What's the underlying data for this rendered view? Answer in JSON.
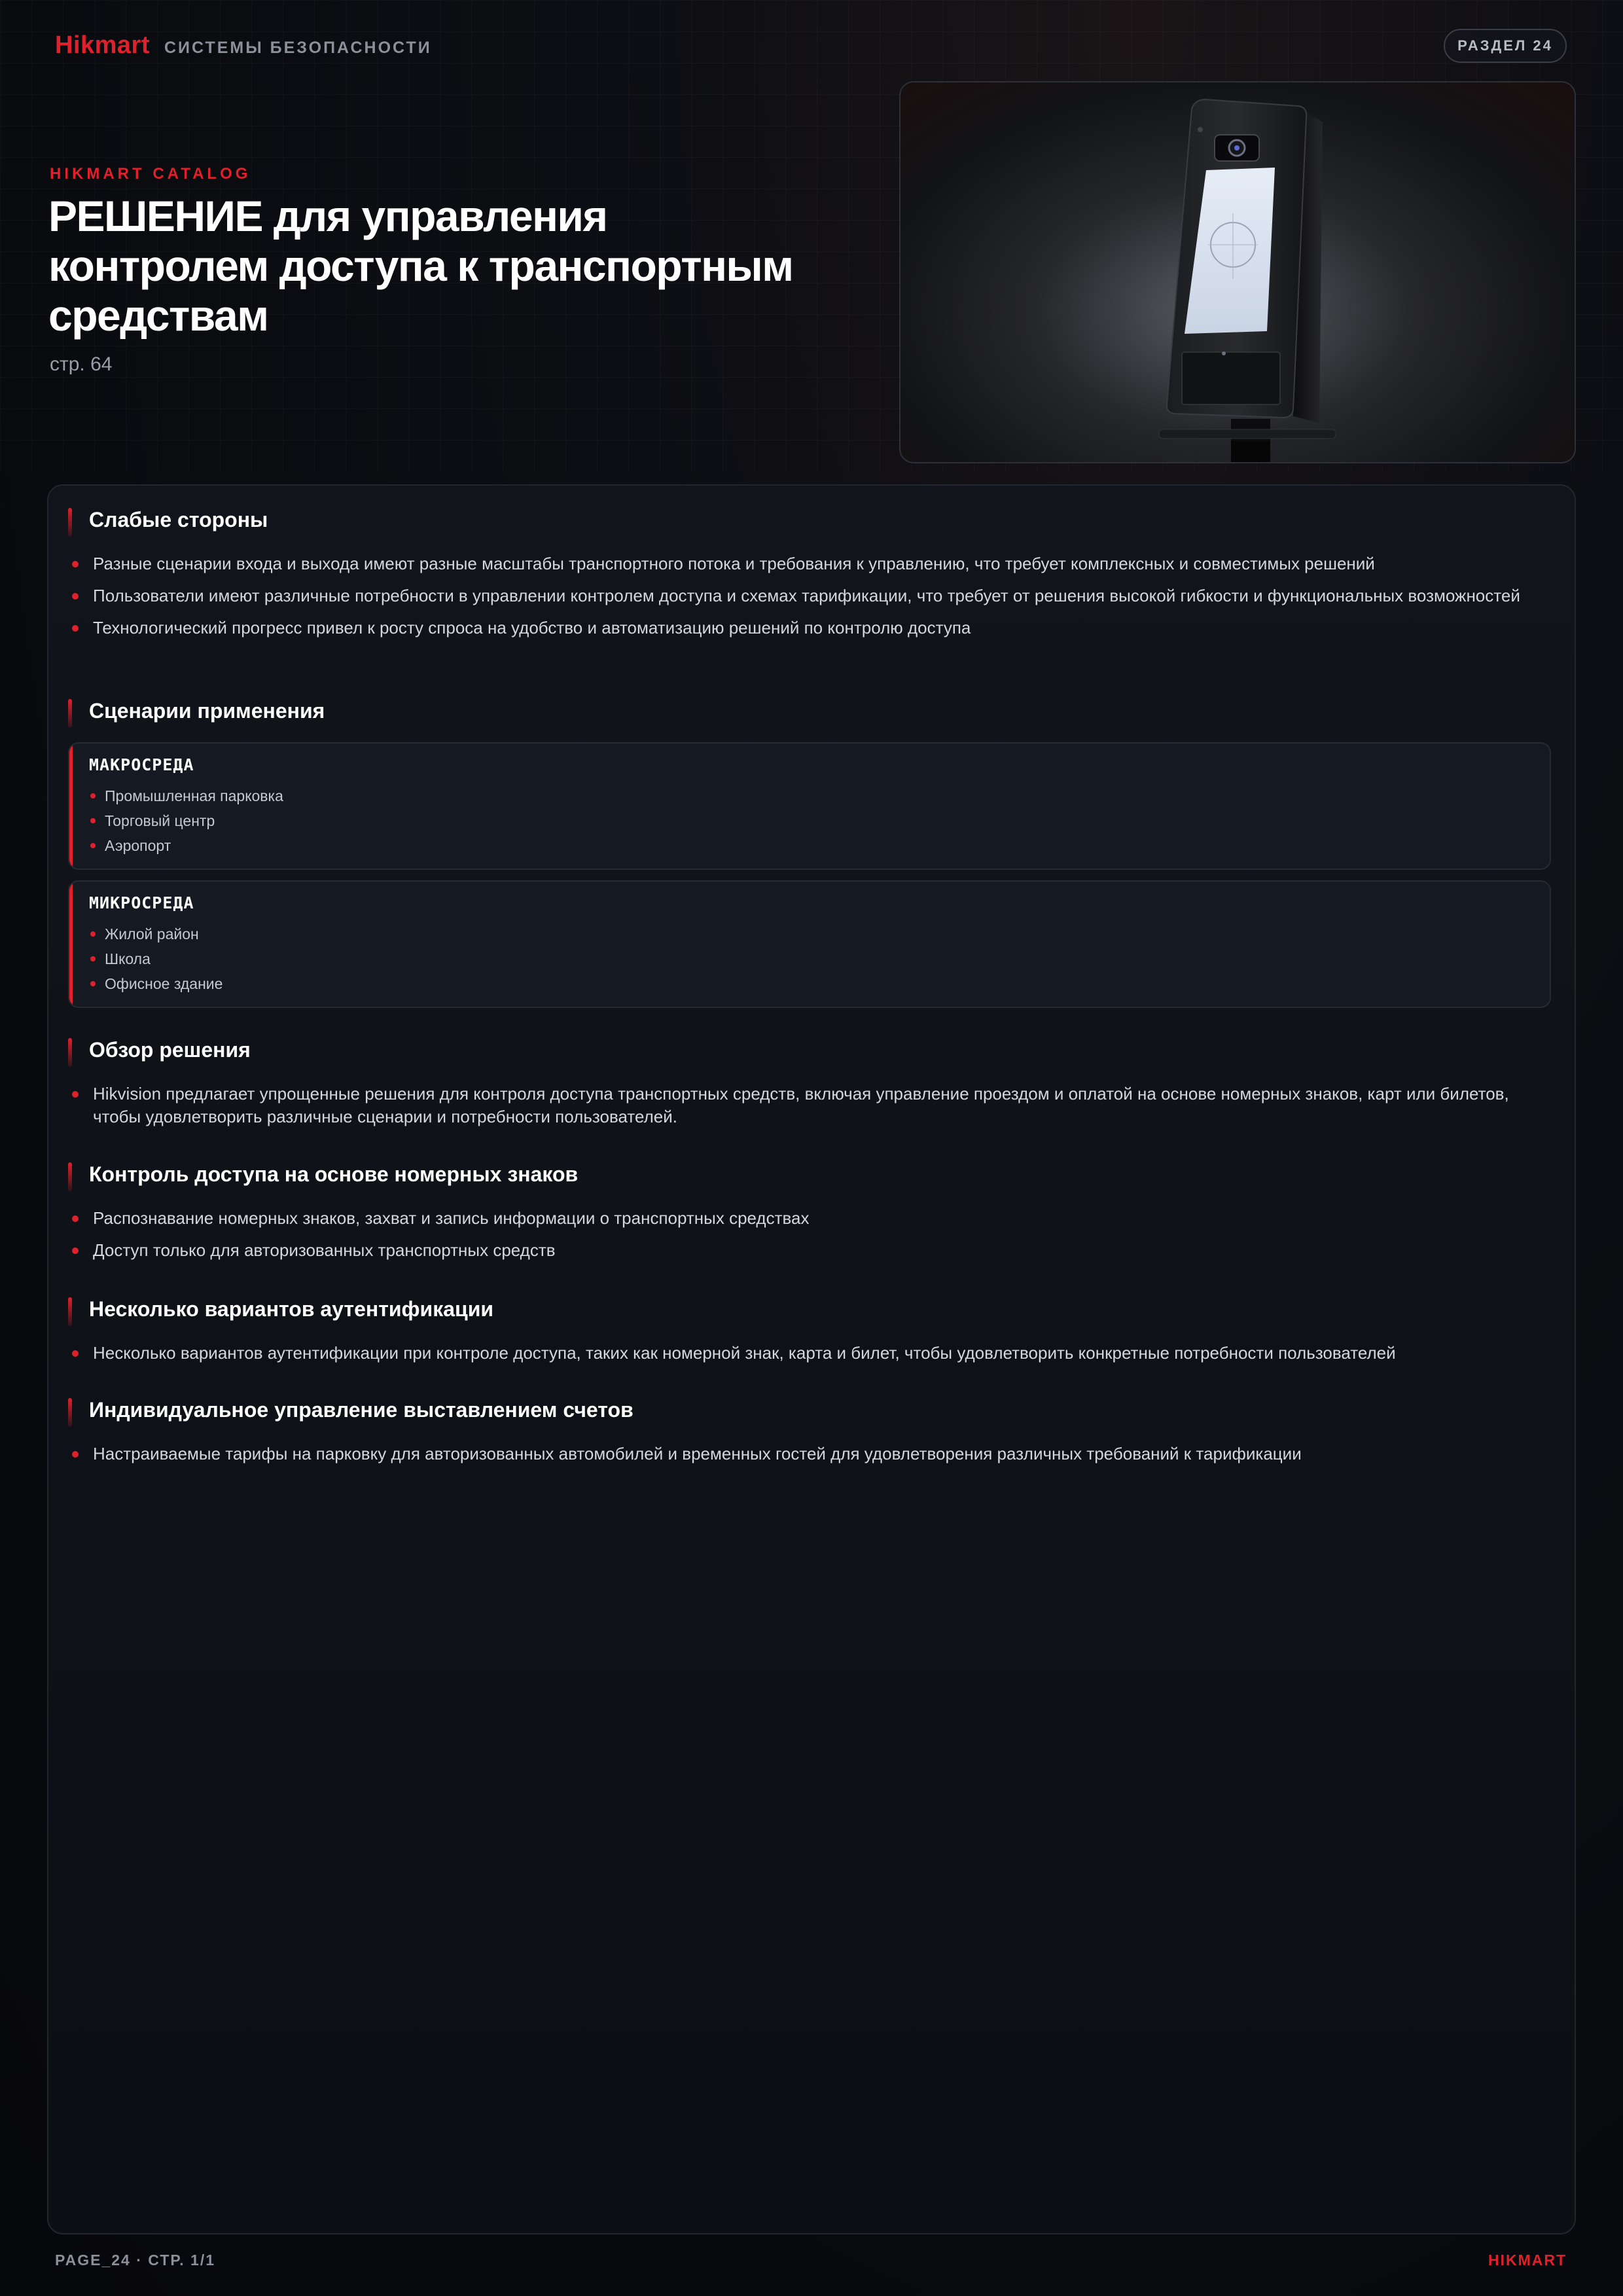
{
  "header": {
    "brand": "Hikmart",
    "tagline": "СИСТЕМЫ БЕЗОПАСНОСТИ",
    "section_badge": "РАЗДЕЛ 24"
  },
  "hero": {
    "kicker": "HIKMART CATALOG",
    "title": "РЕШЕНИЕ для управления контролем доступа к транспортным средствам",
    "page_ref": "стр. 64",
    "image_icon": "access-terminal-device"
  },
  "sections": {
    "weaknesses": {
      "title": "Слабые стороны",
      "items": [
        "Разные сценарии входа и выхода имеют разные масштабы транспортного потока и требования к управлению, что требует комплексных и совместимых решений",
        "Пользователи имеют различные потребности в управлении контролем доступа и схемах тарификации, что требует от решения высокой гибкости и функциональных возможностей",
        "Технологический прогресс привел к росту спроса на удобство и автоматизацию решений по контролю доступа"
      ]
    },
    "scenarios": {
      "title": "Сценарии применения",
      "macro": {
        "title": "МАКРОСРЕДА",
        "items": [
          "Промышленная парковка",
          "Торговый центр",
          "Аэропорт"
        ]
      },
      "micro": {
        "title": "МИКРОСРЕДА",
        "items": [
          "Жилой район",
          "Школа",
          "Офисное здание"
        ]
      }
    },
    "overview": {
      "title": "Обзор решения",
      "items": [
        "Hikvision предлагает упрощенные решения для контроля доступа транспортных средств, включая управление проездом и оплатой на основе номерных знаков, карт или билетов, чтобы удовлетворить различные сценарии и потребности пользователей."
      ]
    },
    "plates": {
      "title": "Контроль доступа на основе номерных знаков",
      "items": [
        "Распознавание номерных знаков, захват и запись информации о транспортных средствах",
        "Доступ только для авторизованных транспортных средств"
      ]
    },
    "auth": {
      "title": "Несколько вариантов аутентификации",
      "items": [
        "Несколько вариантов аутентификации при контроле доступа, таких как номерной знак, карта и билет, чтобы удовлетворить конкретные потребности пользователей"
      ]
    },
    "billing": {
      "title": "Индивидуальное управление выставлением счетов",
      "items": [
        "Настраиваемые тарифы на парковку для авторизованных автомобилей и временных гостей для удовлетворения различных требований к тарификации"
      ]
    }
  },
  "footer": {
    "left": "PAGE_24 · СТР. 1/1",
    "right": "HIKMART"
  },
  "colors": {
    "accent": "#e0202b",
    "background": "#0c0e13",
    "card": "#11141a"
  }
}
